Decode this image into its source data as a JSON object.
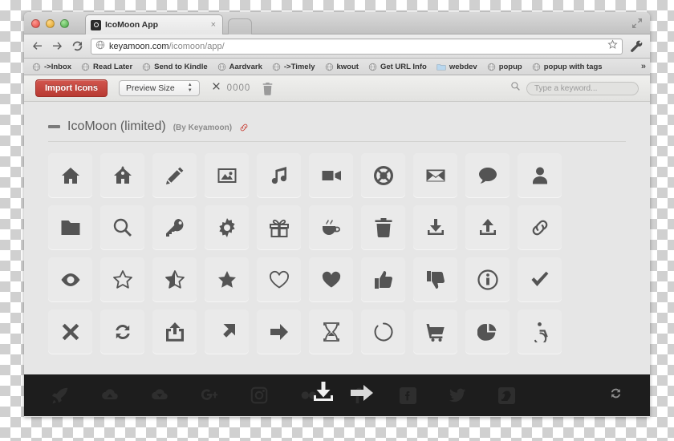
{
  "window": {
    "tab": {
      "title": "IcoMoon App",
      "favicon": "icomoon-favicon",
      "close": "×"
    },
    "newtab_label": "",
    "maximize_icon": "maximize-icon"
  },
  "address_bar": {
    "back": "back-icon",
    "forward": "forward-icon",
    "reload": "reload-icon",
    "site_icon": "globe-icon",
    "url_domain": "keyamoon.com",
    "url_path": "/icomoon/app/",
    "star_icon": "star-icon",
    "wrench_icon": "wrench-icon"
  },
  "bookmarks": {
    "items": [
      {
        "label": "->Inbox",
        "icon": "globe-icon"
      },
      {
        "label": "Read Later",
        "icon": "globe-icon"
      },
      {
        "label": "Send to Kindle",
        "icon": "globe-icon"
      },
      {
        "label": "Aardvark",
        "icon": "globe-icon"
      },
      {
        "label": "->Timely",
        "icon": "globe-icon"
      },
      {
        "label": "kwout",
        "icon": "globe-icon"
      },
      {
        "label": "Get URL Info",
        "icon": "globe-icon"
      },
      {
        "label": "webdev",
        "icon": "folder-icon"
      },
      {
        "label": "popup",
        "icon": "globe-icon"
      },
      {
        "label": "popup with tags",
        "icon": "globe-icon"
      }
    ],
    "overflow": "»"
  },
  "toolbar": {
    "import_label": "Import Icons",
    "preview_size_label": "Preview Size",
    "selection_count": "0000",
    "selection_icon": "cross-icon",
    "trash_icon": "trash-icon",
    "search_icon": "search-icon",
    "search_placeholder": "Type a keyword..."
  },
  "icon_set": {
    "collapse_icon": "collapse-minus-icon",
    "name": "IcoMoon (limited)",
    "author": "(By Keyamoon)",
    "link_icon": "link-icon",
    "link_color": "#c9483f"
  },
  "grid": {
    "icons": [
      "home",
      "home2",
      "pencil",
      "image",
      "music",
      "video-camera",
      "support",
      "envelope",
      "bubble",
      "user",
      "folder",
      "search",
      "key",
      "cog",
      "gift",
      "coffee",
      "trash",
      "download",
      "upload",
      "link",
      "eye",
      "star-empty",
      "star-half",
      "star-full",
      "heart-empty",
      "heart-full",
      "thumbs-up",
      "thumbs-down",
      "info",
      "checkmark",
      "cross",
      "loop",
      "share",
      "arrow-up-right",
      "arrow-right",
      "hourglass",
      "spinner",
      "cart",
      "pie-chart",
      "accessibility"
    ]
  },
  "footer": {
    "icons": [
      "rocket-icon",
      "cloud-down-icon",
      "cloud-up-icon",
      "google-plus-icon",
      "instagram-icon",
      "flickr-icon",
      "facebook-f-icon",
      "facebook-square-icon",
      "twitter-icon",
      "vimeo-icon"
    ],
    "overlay_download": "download-tray-icon",
    "overlay_arrow": "arrow-right-icon",
    "refresh": "refresh-icon"
  },
  "colors": {
    "accent_red": "#c24a42",
    "app_bg": "#e6e6e6",
    "icon_tile": "#eaeaea",
    "icon_fill": "#545454",
    "footer_bg": "#1d1d1d"
  }
}
